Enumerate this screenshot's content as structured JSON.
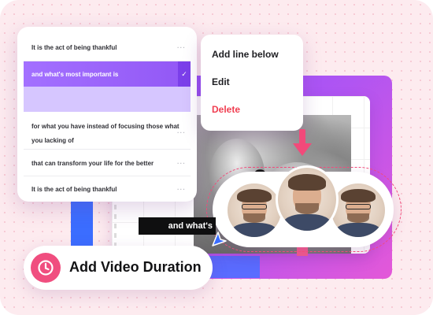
{
  "subtitle_list": {
    "rows": [
      {
        "text": "It is the act of being thankful"
      },
      {
        "text": "and what's most important is"
      },
      {
        "text": "for what you have instead of focusing those what you lacking of"
      },
      {
        "text": "that can transform your life for the better"
      },
      {
        "text": "It is the act of being thankful"
      }
    ],
    "more_glyph": "···",
    "check_glyph": "✓"
  },
  "context_menu": {
    "add_line_below": "Add line below",
    "edit": "Edit",
    "delete": "Delete"
  },
  "canvas": {
    "partial_letter": "s"
  },
  "caption_label": "and what's",
  "duration_button": {
    "label": "Add Video Duration"
  },
  "colors": {
    "accent_purple": "#9257f5",
    "accent_pink": "#f04e7f",
    "delete_red": "#f03e51",
    "cursor_blue": "#3b6dff"
  },
  "icons": {
    "clock": "clock-icon",
    "cursor": "cursor-arrow-icon",
    "arrow": "arrow-down-icon"
  }
}
